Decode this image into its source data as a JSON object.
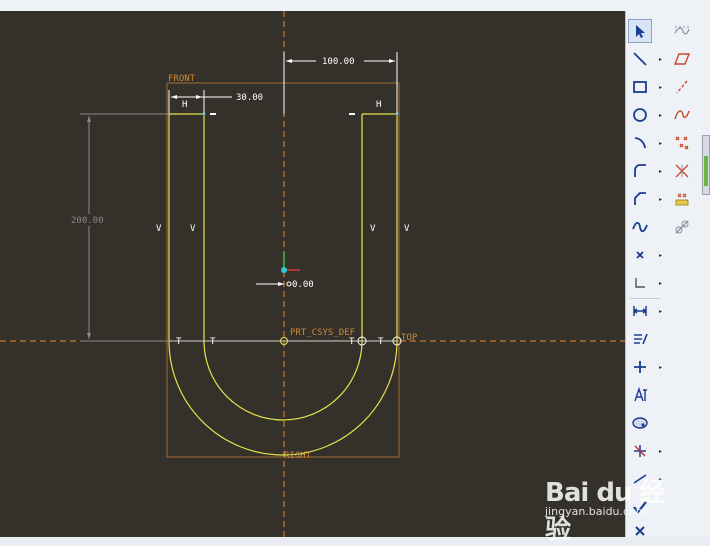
{
  "sketch": {
    "dim_top_width": "100.00",
    "dim_slot_width": "30.00",
    "dim_height": "200.00",
    "dim_center": "0.00",
    "label_front": "FRONT",
    "label_right": "RIGHT",
    "label_top": "TOP",
    "label_csys": "PRT_CSYS_DEF",
    "constraint_h": "H",
    "constraint_v": "V",
    "constraint_t": "T"
  },
  "toolbar": {
    "tools_left": [
      "select-icon",
      "line-icon",
      "rectangle-icon",
      "circle-icon",
      "arc-icon",
      "fillet-icon",
      "spline-icon",
      "point-icon",
      "coordinate-system-icon",
      "dimension-icon",
      "modify-icon",
      "constraint-icon",
      "text-icon",
      "palette-icon",
      "trim-icon",
      "divide-icon",
      "accept-icon",
      "cancel-icon"
    ],
    "tools_right": [
      "offset-curve-icon",
      "plane-icon",
      "axis-icon",
      "curve-icon",
      "points-icon",
      "csys-point-icon",
      "datum-feature-icon",
      "analysis-icon"
    ]
  },
  "watermark": {
    "logo": "Bai du 经验",
    "url": "jingyan.baidu.com"
  },
  "colors": {
    "background": "#333129",
    "sketch_geometry": "#e9e24b",
    "dimension": "#ffffff",
    "reference": "#d0893b",
    "accent": "#e88d2c"
  }
}
